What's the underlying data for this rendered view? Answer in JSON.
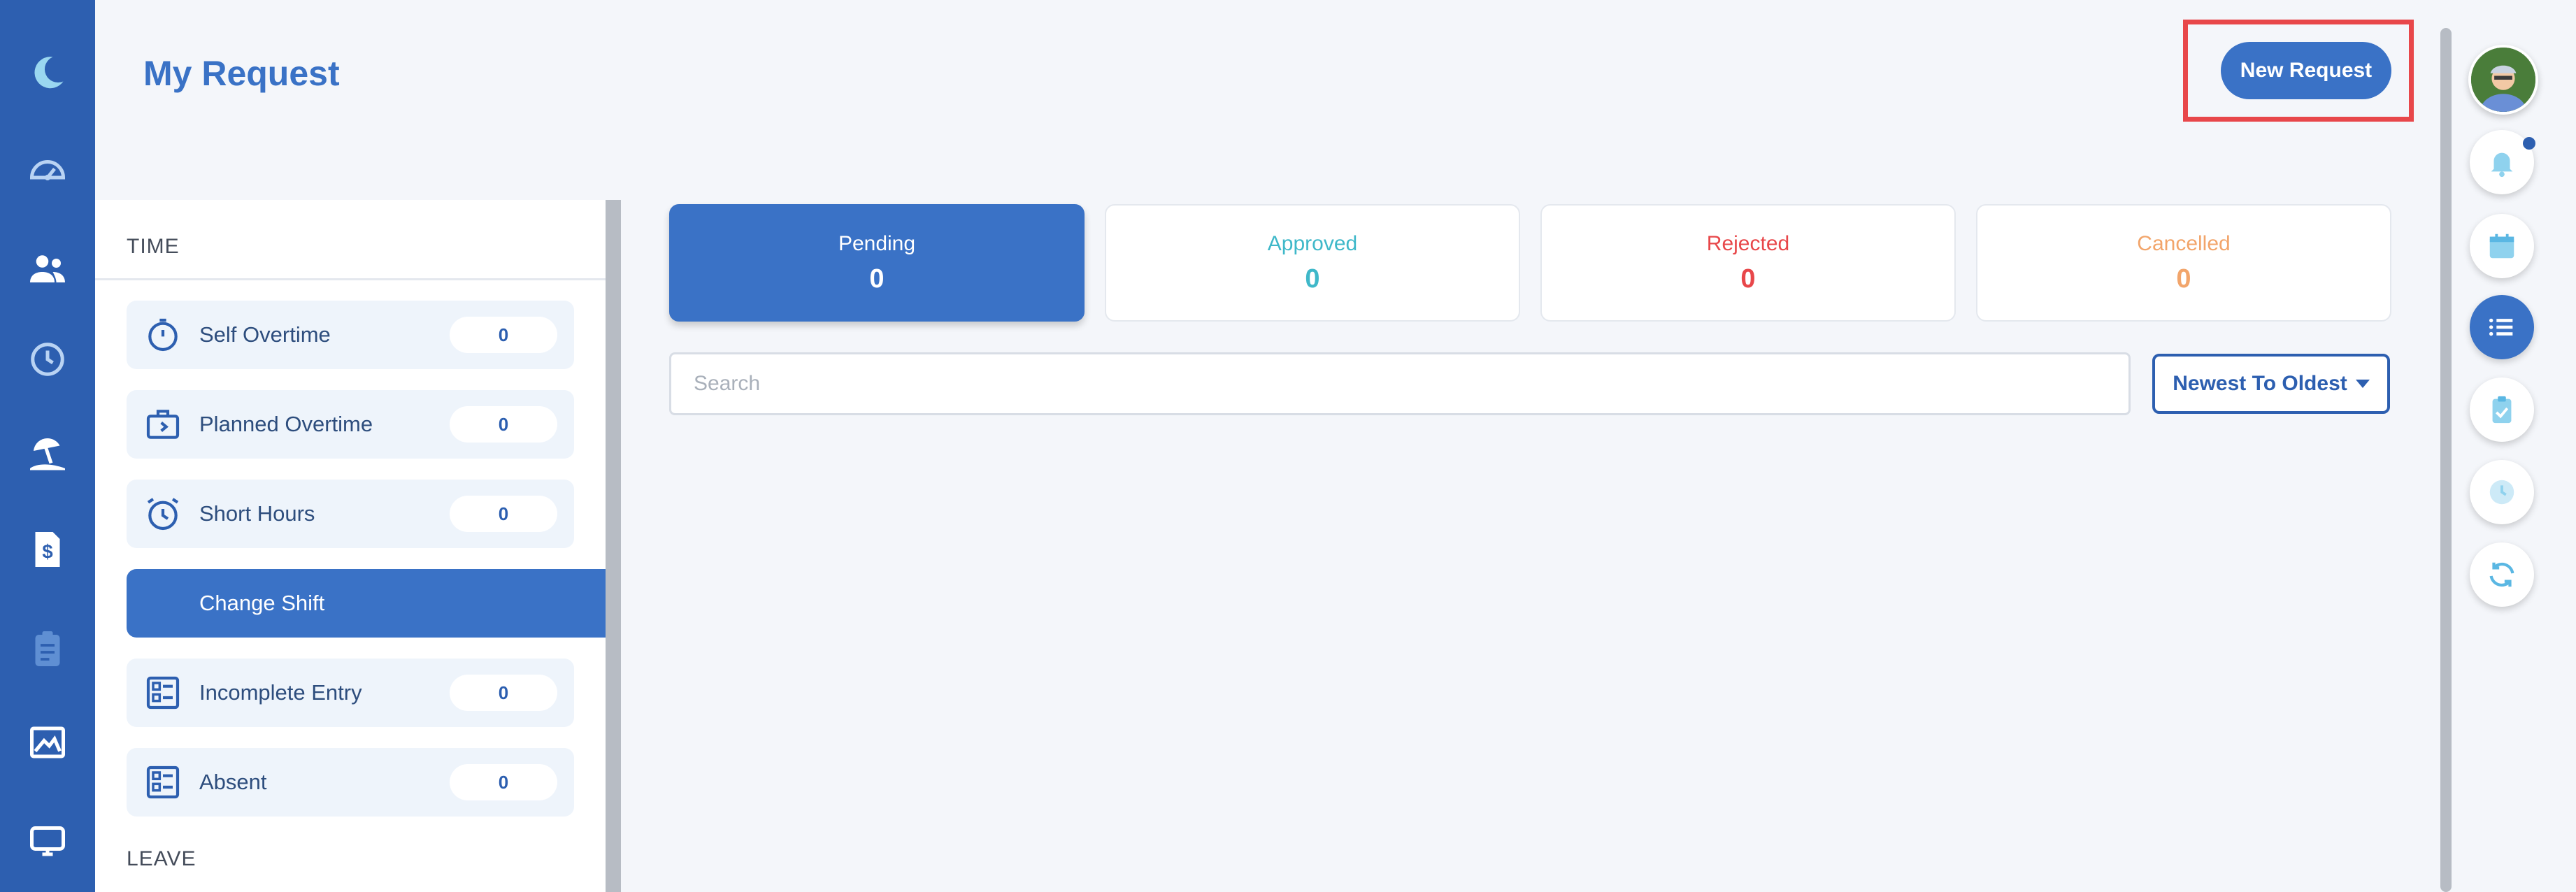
{
  "header": {
    "title": "My Request",
    "new_request_label": "New Request"
  },
  "nav": {
    "icons": [
      "moon-logo-icon",
      "dashboard-gauge-icon",
      "users-icon",
      "history-clock-icon",
      "vacation-beach-icon",
      "payroll-dollar-doc-icon",
      "clipboard-list-icon",
      "chart-image-icon",
      "monitor-icon"
    ]
  },
  "panel": {
    "time_heading": "TIME",
    "leave_heading": "LEAVE",
    "items": [
      {
        "label": "Self Overtime",
        "count": "0",
        "icon": "stopwatch-icon"
      },
      {
        "label": "Planned Overtime",
        "count": "0",
        "icon": "briefcase-icon"
      },
      {
        "label": "Short Hours",
        "count": "0",
        "icon": "alarm-clock-icon"
      },
      {
        "label": "Change Shift",
        "icon": "swap-shift-icon"
      },
      {
        "label": "Incomplete Entry",
        "count": "0",
        "icon": "checklist-form-icon"
      },
      {
        "label": "Absent",
        "count": "0",
        "icon": "checklist-form-icon"
      }
    ]
  },
  "status_tabs": [
    {
      "label": "Pending",
      "count": "0",
      "color": "#ffffff",
      "active": true
    },
    {
      "label": "Approved",
      "count": "0",
      "color": "#3fb8c9"
    },
    {
      "label": "Rejected",
      "count": "0",
      "color": "#e8474a"
    },
    {
      "label": "Cancelled",
      "count": "0",
      "color": "#f2a56b"
    }
  ],
  "search": {
    "placeholder": "Search",
    "value": ""
  },
  "sort": {
    "selected": "Newest To Oldest"
  },
  "rail": {
    "buttons": [
      "bell-icon",
      "calendar-icon",
      "list-icon",
      "clipboard-check-icon",
      "clock-icon",
      "refresh-icon"
    ],
    "active": "list-icon"
  },
  "colors": {
    "primary": "#3a72c6",
    "nav": "#2d5fb0",
    "highlight": "#e8474a"
  }
}
